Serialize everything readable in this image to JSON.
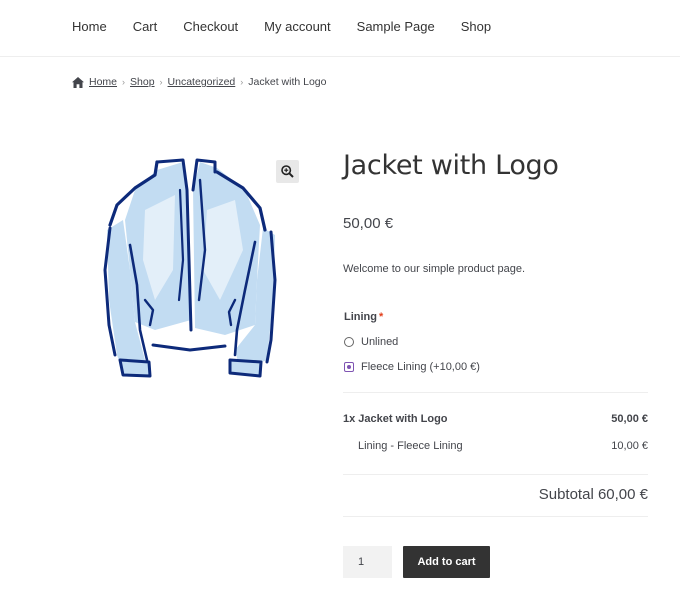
{
  "nav": {
    "items": [
      "Home",
      "Cart",
      "Checkout",
      "My account",
      "Sample Page",
      "Shop"
    ]
  },
  "breadcrumb": {
    "home": "Home",
    "shop": "Shop",
    "category": "Uncategorized",
    "current": "Jacket with Logo"
  },
  "product": {
    "title": "Jacket with Logo",
    "price": "50,00 €",
    "description": "Welcome to our simple product page.",
    "image_icon": "jacket-illustration"
  },
  "options": {
    "label": "Lining",
    "required_mark": "*",
    "choices": [
      "Unlined",
      "Fleece Lining (+10,00 €)"
    ],
    "selected": "Fleece Lining (+10,00 €)"
  },
  "summary": {
    "item_label": "1x Jacket with Logo",
    "item_price": "50,00 €",
    "addon_label": "Lining - Fleece Lining",
    "addon_price": "10,00 €",
    "subtotal": "Subtotal 60,00 €"
  },
  "cart": {
    "quantity": "1",
    "add_label": "Add to cart"
  },
  "colors": {
    "jacket_fill": "#c2dcf2",
    "jacket_outline": "#0d2a7a",
    "radio_accent": "#7f54b3",
    "button_bg": "#333333",
    "required": "#e2401c"
  }
}
